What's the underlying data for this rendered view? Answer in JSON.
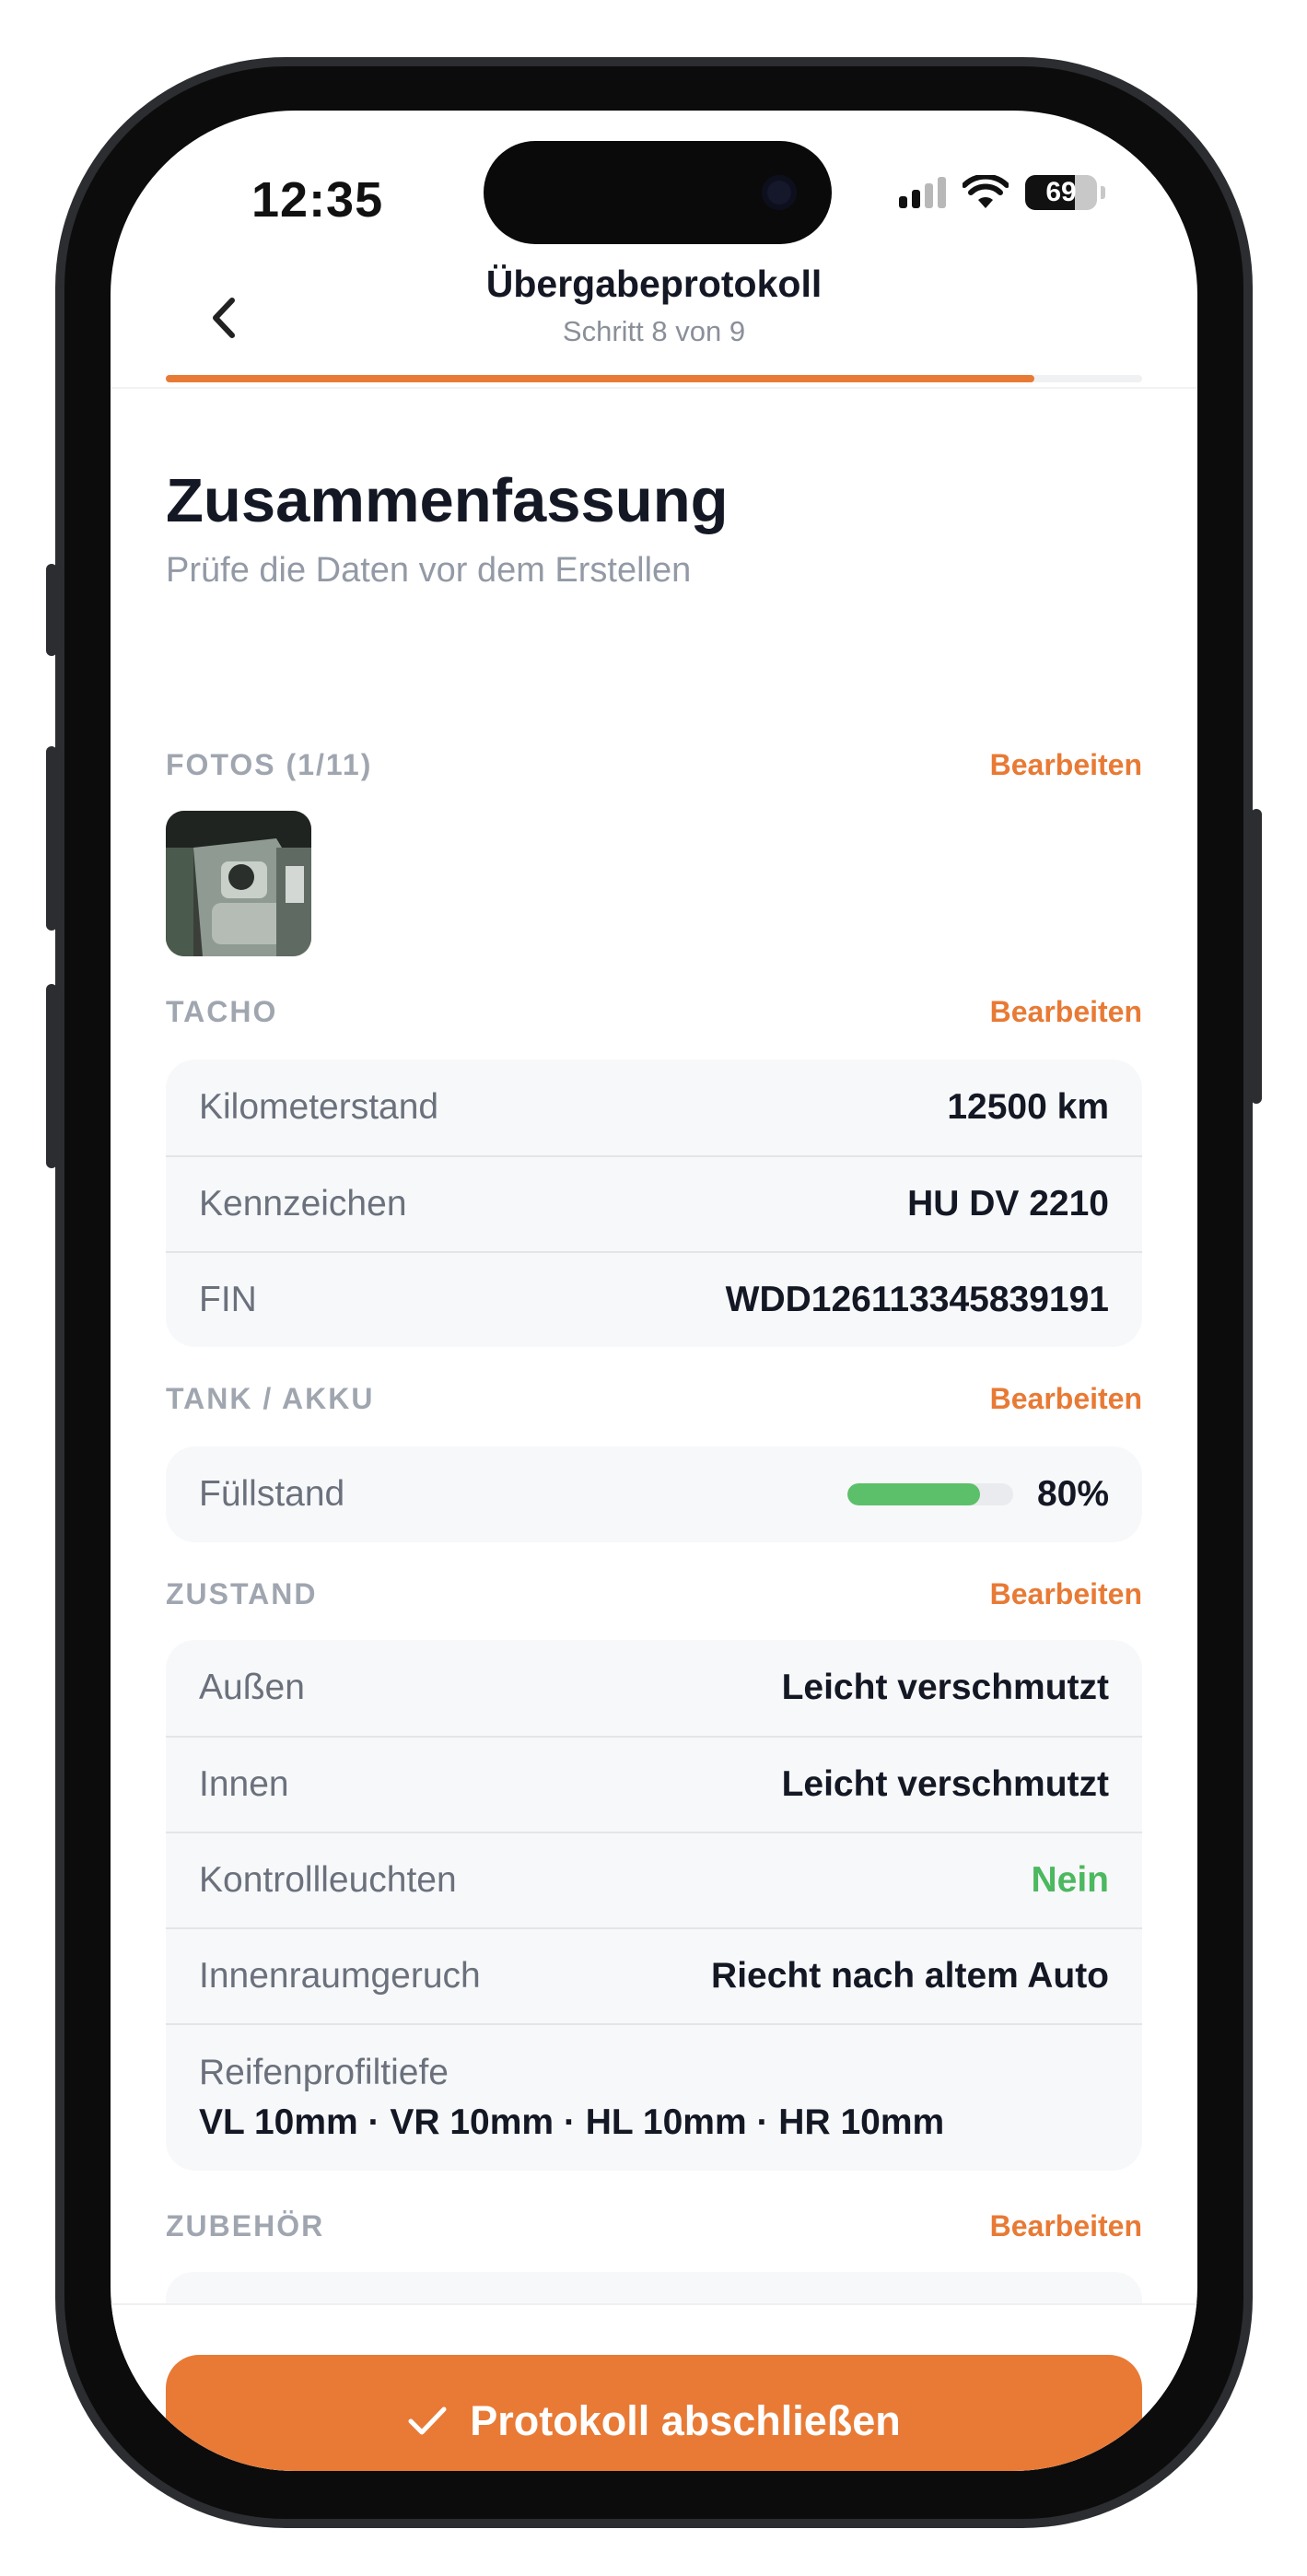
{
  "status_bar": {
    "time": "12:35",
    "battery": "69"
  },
  "header": {
    "title": "Übergabeprotokoll",
    "step": "Schritt 8 von 9",
    "progress": 0.89
  },
  "page": {
    "title": "Zusammenfassung",
    "subtitle": "Prüfe die Daten vor dem Erstellen"
  },
  "edit_label": "Bearbeiten",
  "fotos": {
    "label": "FOTOS (1/11)"
  },
  "tacho": {
    "label": "TACHO",
    "rows": [
      {
        "label": "Kilometerstand",
        "value": "12500 km"
      },
      {
        "label": "Kennzeichen",
        "value": "HU DV 2210"
      },
      {
        "label": "FIN",
        "value": "WDD126113345839191"
      }
    ]
  },
  "tank": {
    "label": "TANK / AKKU",
    "fill_label": "Füllstand",
    "fill_value": "80%",
    "fill_level": 0.8
  },
  "zustand": {
    "label": "ZUSTAND",
    "rows": [
      {
        "label": "Außen",
        "value": "Leicht verschmutzt"
      },
      {
        "label": "Innen",
        "value": "Leicht verschmutzt"
      },
      {
        "label": "Kontrollleuchten",
        "value": "Nein"
      },
      {
        "label": "Innenraumgeruch",
        "value": "Riecht nach altem Auto"
      }
    ],
    "tires_label": "Reifenprofiltiefe",
    "tires_value": "VL 10mm · VR 10mm · HL 10mm · HR 10mm"
  },
  "zubehoer": {
    "label": "ZUBEHÖR"
  },
  "cta": {
    "label": "Protokoll abschließen"
  },
  "colors": {
    "accent": "#e87a35",
    "success": "#4cb85f",
    "text": "#141824",
    "muted": "#939aa6"
  }
}
